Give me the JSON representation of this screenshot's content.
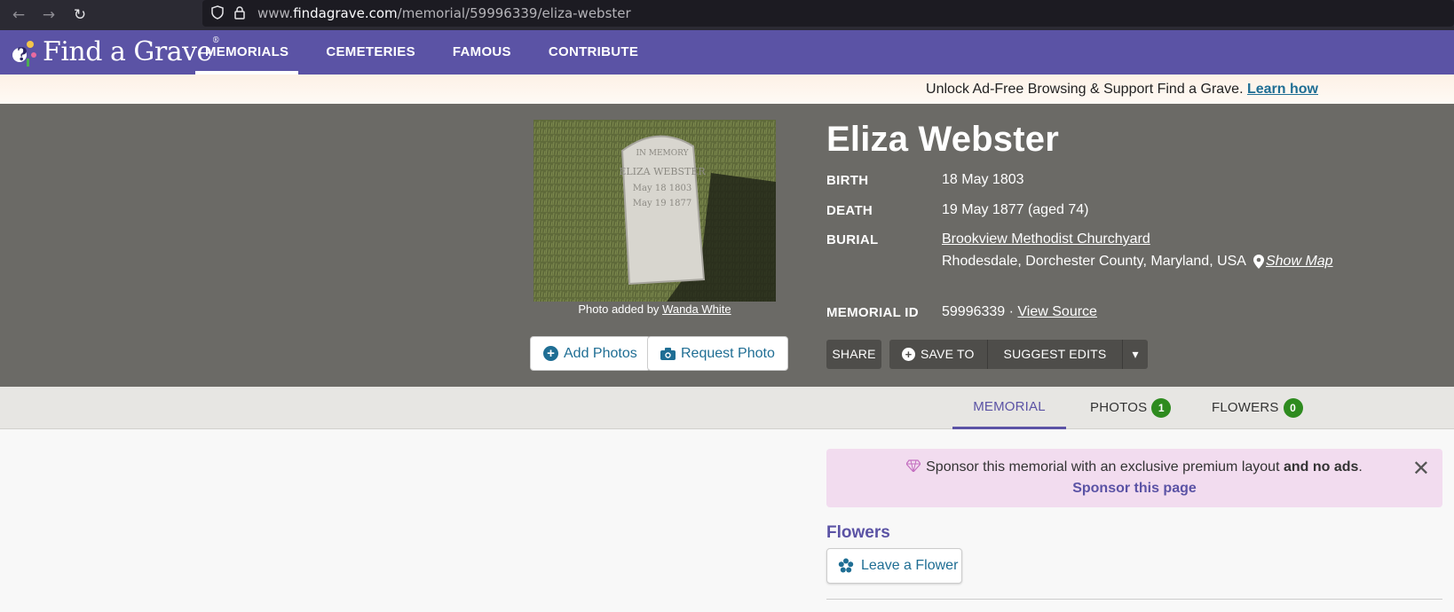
{
  "browser": {
    "back_glyph": "←",
    "forward_glyph": "→",
    "reload_glyph": "↻",
    "url_prefix": "www.",
    "url_host": "findagrave.com",
    "url_path": "/memorial/59996339/eliza-webster"
  },
  "header": {
    "logo_text": "Find a Grave",
    "logo_mark": "®",
    "nav": {
      "memorials": "MEMORIALS",
      "cemeteries": "CEMETERIES",
      "famous": "FAMOUS",
      "contribute": "CONTRIBUTE"
    }
  },
  "promo": {
    "text": "Unlock Ad-Free Browsing & Support Find a Grave.",
    "link": "Learn how"
  },
  "memorial": {
    "name": "Eliza Webster",
    "birth_label": "BIRTH",
    "birth": "18 May 1803",
    "death_label": "DEATH",
    "death": "19 May 1877 (aged 74)",
    "burial_label": "BURIAL",
    "cemetery": "Brookview Methodist Churchyard",
    "location": "Rhodesdale, Dorchester County, Maryland, USA",
    "show_map": "Show Map",
    "id_label": "MEMORIAL ID",
    "id": "59996339",
    "id_sep": "·",
    "view_source": "View Source"
  },
  "photo": {
    "caption_prefix": "Photo added by",
    "added_by": "Wanda White",
    "stone_text": [
      "IN MEMORY",
      "ELIZA WEBSTER",
      "May 18 1803",
      "May 19 1877"
    ]
  },
  "actions": {
    "add_photos": "Add Photos",
    "request_photo": "Request Photo",
    "share": "SHARE",
    "save_to": "SAVE TO",
    "suggest_edits": "SUGGEST EDITS",
    "more_glyph": "▾"
  },
  "tabs": {
    "memorial": "MEMORIAL",
    "photos": "PHOTOS",
    "photos_count": "1",
    "flowers": "FLOWERS",
    "flowers_count": "0"
  },
  "sponsor": {
    "text": "Sponsor this memorial with an exclusive premium layout",
    "bold_text": "and no ads",
    "period": ".",
    "link": "Sponsor this page",
    "close_glyph": "✕"
  },
  "flowers": {
    "heading": "Flowers",
    "leave_flower": "Leave a Flower"
  },
  "colors": {
    "brand_purple": "#5b53a5",
    "link_blue": "#1f6e94",
    "badge_green": "#2e8b1f",
    "hero_gray": "#6b6a66"
  }
}
